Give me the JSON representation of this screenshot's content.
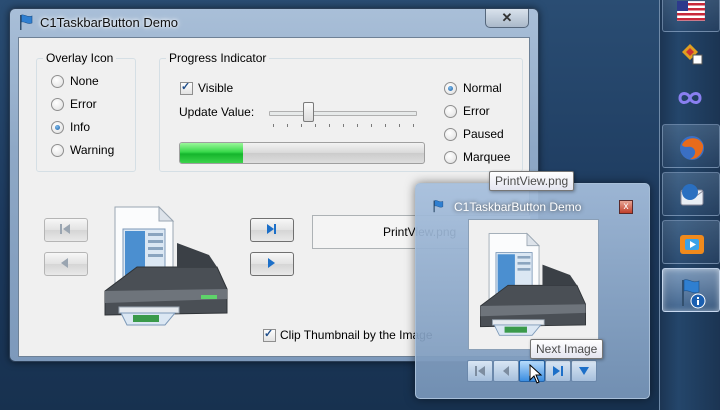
{
  "window": {
    "title": "C1TaskbarButton Demo",
    "close_label": "✕"
  },
  "overlay": {
    "legend": "Overlay Icon",
    "options": [
      {
        "label": "None",
        "selected": false
      },
      {
        "label": "Error",
        "selected": false
      },
      {
        "label": "Info",
        "selected": true
      },
      {
        "label": "Warning",
        "selected": false
      }
    ]
  },
  "progress": {
    "legend": "Progress Indicator",
    "visible_label": "Visible",
    "visible_checked": true,
    "update_label": "Update Value:",
    "value_fraction": 0.26,
    "bar_fraction": 0.26,
    "states": [
      {
        "label": "Normal",
        "selected": true
      },
      {
        "label": "Error",
        "selected": false
      },
      {
        "label": "Paused",
        "selected": false
      },
      {
        "label": "Marquee",
        "selected": false
      }
    ]
  },
  "image": {
    "name": "PrintView.png",
    "clip_label": "Clip Thumbnail by the Image",
    "clip_checked": true
  },
  "preview": {
    "title": "C1TaskbarButton Demo",
    "close_label": "x",
    "tooltip_name": "PrintView.png",
    "tooltip_button": "Next Image"
  },
  "colors": {
    "accent": "#1a5c9e",
    "progress_green": "#15b52c"
  }
}
